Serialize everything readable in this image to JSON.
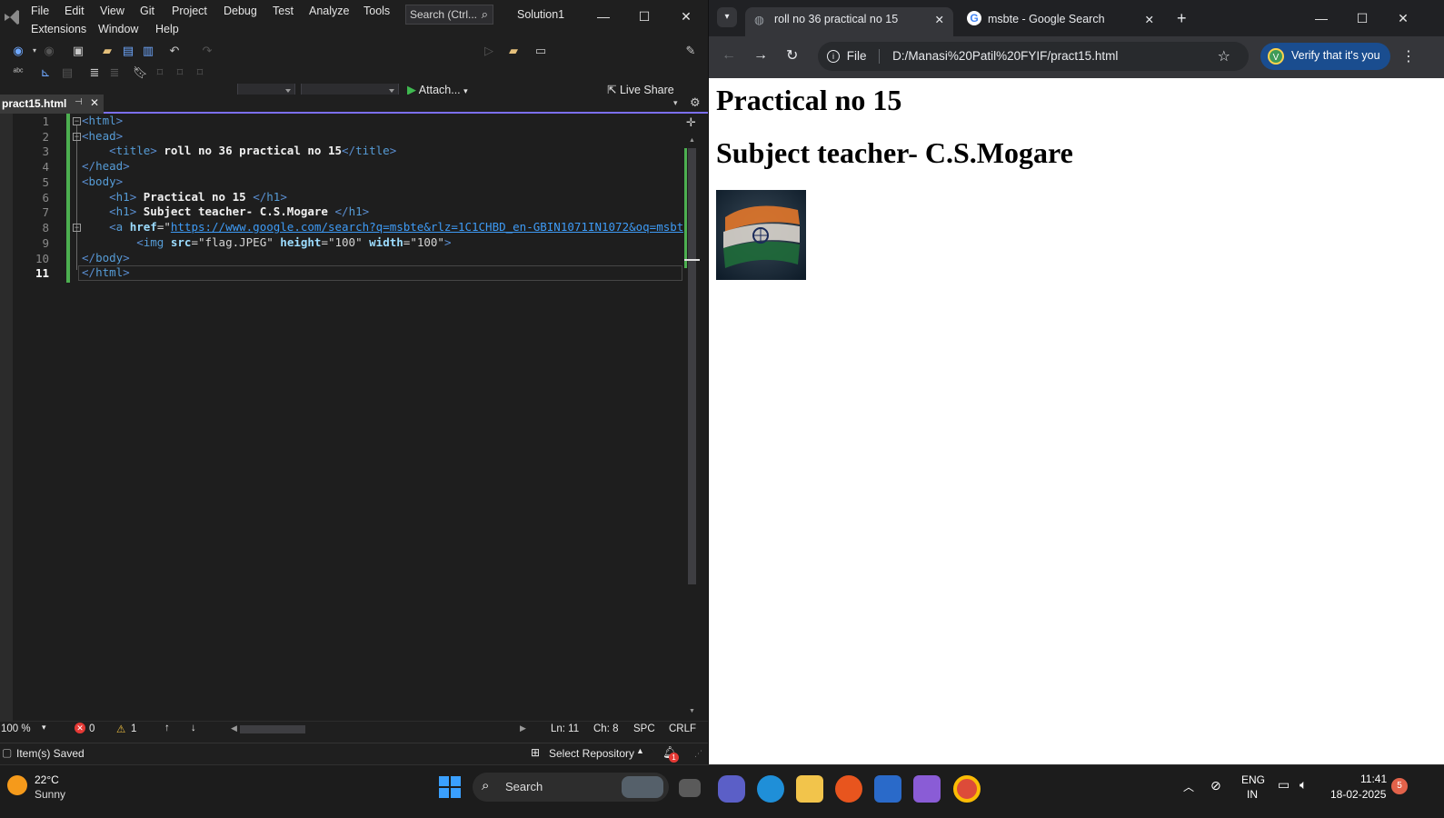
{
  "vs": {
    "menu": {
      "row1": [
        "File",
        "Edit",
        "View",
        "Git",
        "Project",
        "Debug",
        "Test",
        "Analyze",
        "Tools"
      ],
      "row2": [
        "Extensions",
        "Window",
        "Help"
      ],
      "search_label": "Search (Ctrl...",
      "solution": "Solution1"
    },
    "toolbar": {
      "attach_label": "Attach...",
      "live_share_label": "Live Share"
    },
    "tab": {
      "filename": "pract15.html"
    },
    "editor": {
      "line_numbers": [
        "1",
        "2",
        "3",
        "4",
        "5",
        "6",
        "7",
        "8",
        "9",
        "10",
        "11"
      ],
      "title_text": "roll no 36 practical no 15",
      "h1_1_text": "Practical no 15",
      "h1_2_text": "Subject teacher- C.S.Mogare",
      "href_attr": "href",
      "href_value": "https://www.google.com/search?q=msbte&rlz=1C1CHBD_en-GBIN1071IN1072&oq=msbt",
      "img_src": "\"flag.JPEG\"",
      "img_height": "\"100\"",
      "img_width": "\"100\""
    },
    "status": {
      "zoom": "100 %",
      "errors": "0",
      "warnings": "1",
      "line": "Ln: 11",
      "col": "Ch: 8",
      "indent": "SPC",
      "eol": "CRLF",
      "saved": "Item(s) Saved",
      "select_repo": "Select Repository",
      "notif_count": "1"
    }
  },
  "chrome": {
    "tabs": [
      {
        "title": "roll no 36 practical no 15"
      },
      {
        "title": "msbte - Google Search"
      }
    ],
    "address": {
      "scheme": "File",
      "url": "D:/Manasi%20Patil%20FYIF/pract15.html"
    },
    "verify_label": "Verify that it's you",
    "profile_initial": "V",
    "page": {
      "h1_a": "Practical no 15",
      "h1_b": "Subject teacher- C.S.Mogare"
    }
  },
  "taskbar": {
    "weather_temp": "22°C",
    "weather_desc": "Sunny",
    "search_label": "Search",
    "lang_top": "ENG",
    "lang_bottom": "IN",
    "time": "11:41",
    "date": "18-02-2025",
    "notif_count": "5"
  },
  "colors": {
    "vs_background": "#1f1f1f",
    "vs_accent": "#7c6ff0",
    "chrome_dark": "#202124",
    "link_blue": "#3e9bf6"
  }
}
